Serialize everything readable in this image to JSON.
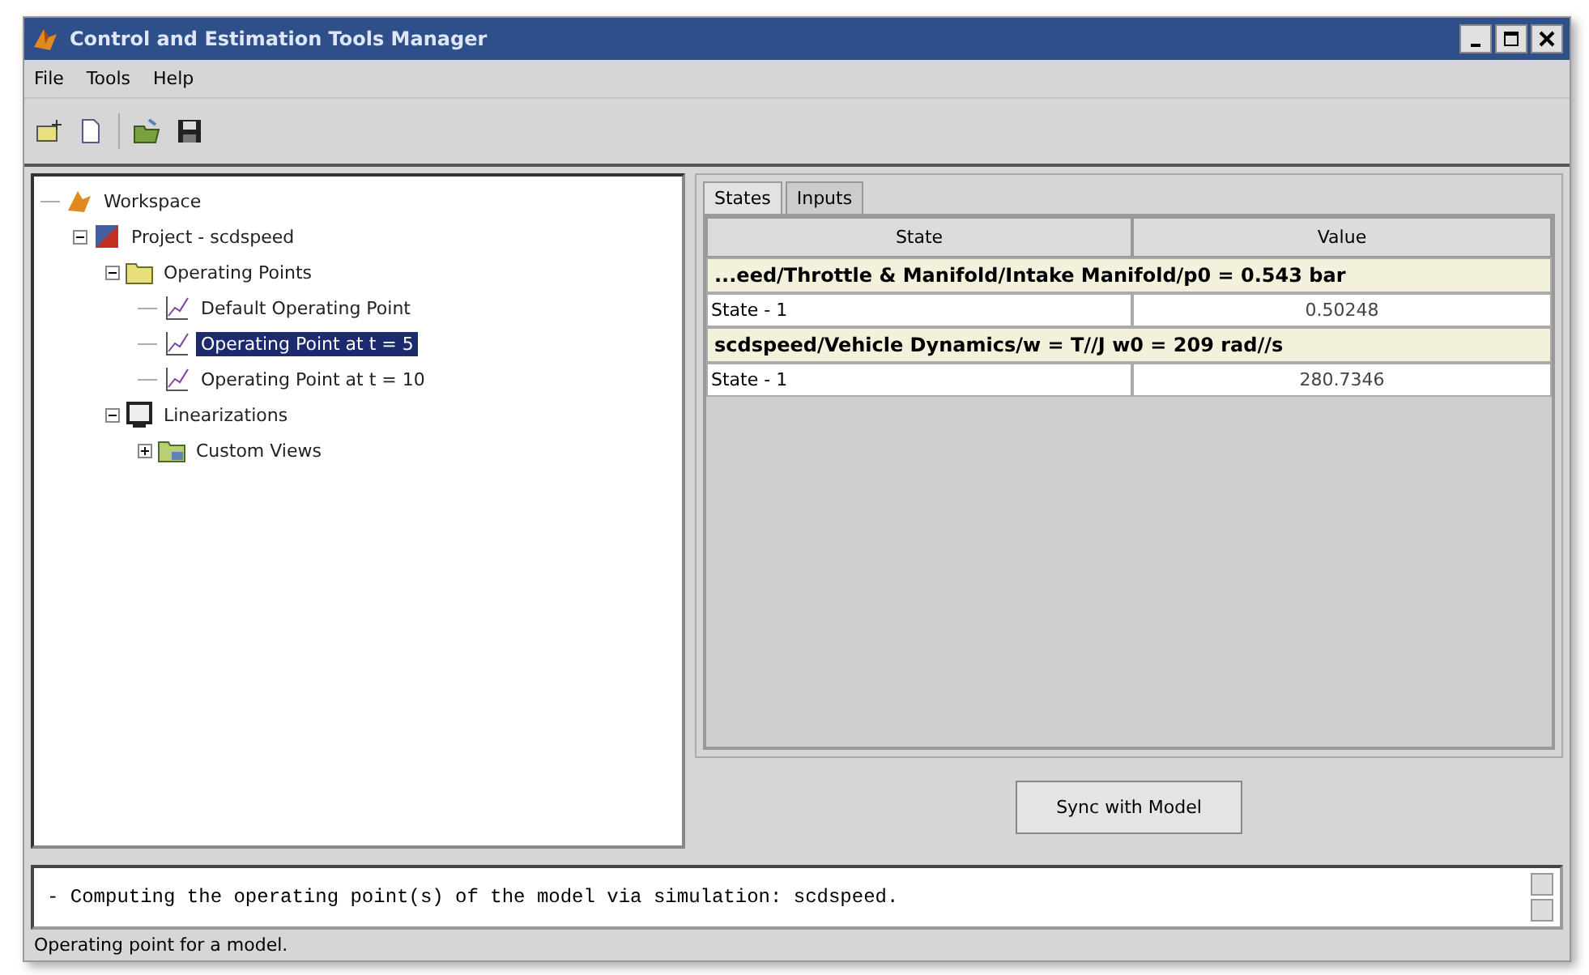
{
  "window": {
    "title": "Control and Estimation Tools Manager"
  },
  "menu": [
    "File",
    "Tools",
    "Help"
  ],
  "toolbar": [
    {
      "kind": "new-project"
    },
    {
      "kind": "new-file"
    },
    {
      "kind": "open"
    },
    {
      "kind": "save"
    }
  ],
  "tree": {
    "items": [
      {
        "label": "Workspace",
        "kind": "workspace",
        "selected": false,
        "children": [
          {
            "label": "Project - scdspeed",
            "kind": "project",
            "selected": false,
            "expanded": true,
            "children": [
              {
                "label": "Operating Points",
                "kind": "folder",
                "selected": false,
                "expanded": true,
                "children": [
                  {
                    "label": "Default Operating Point",
                    "kind": "plot",
                    "selected": false
                  },
                  {
                    "label": "Operating Point at t = 5",
                    "kind": "plot",
                    "selected": true
                  },
                  {
                    "label": "Operating Point at t = 10",
                    "kind": "plot",
                    "selected": false
                  }
                ]
              },
              {
                "label": "Linearizations",
                "kind": "linearization",
                "selected": false,
                "expanded": true,
                "children": [
                  {
                    "label": "Custom Views",
                    "kind": "views",
                    "selected": false,
                    "expanded": false
                  }
                ]
              }
            ]
          }
        ]
      }
    ]
  },
  "tabs": [
    {
      "label": "States",
      "selected": true
    },
    {
      "label": "Inputs",
      "selected": false
    }
  ],
  "table": {
    "columns": [
      "State",
      "Value"
    ],
    "rows": [
      {
        "kind": "group",
        "text": "...eed/Throttle & Manifold/Intake Manifold/p0 = 0.543 bar"
      },
      {
        "kind": "state",
        "cells": [
          "State - 1",
          "0.50248"
        ]
      },
      {
        "kind": "group",
        "text": "scdspeed/Vehicle Dynamics/w = T//J w0 = 209 rad//s"
      },
      {
        "kind": "state",
        "cells": [
          "State - 1",
          "280.7346"
        ]
      }
    ]
  },
  "sync_button": "Sync with Model",
  "log": "- Computing the operating point(s) of the model via simulation: scdspeed.",
  "status_bar": "Operating point for a model."
}
